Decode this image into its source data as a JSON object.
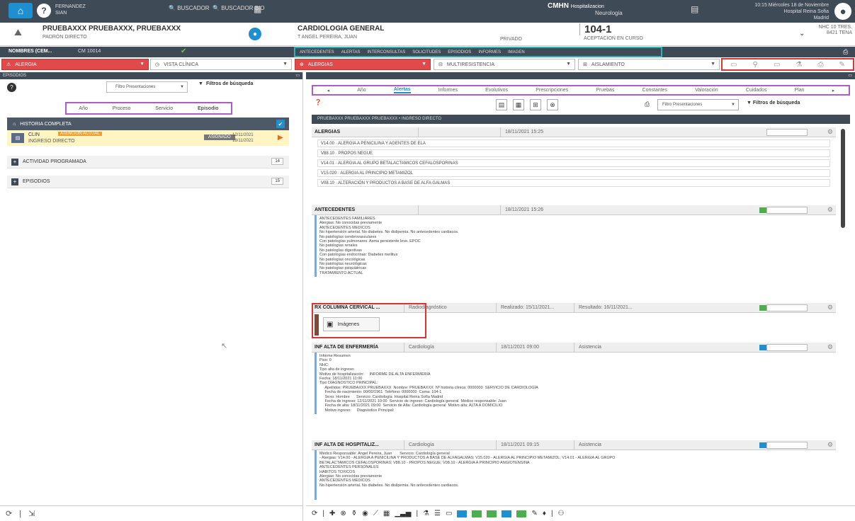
{
  "topbar": {
    "user_line1": "FERNANDEZ",
    "user_line2": "SIAN",
    "link1": "BUSCADOR",
    "link2": "BUSCADOR BIO",
    "center_title": "CMHN",
    "center_role": "Hospitalizacion",
    "center_sub": "Neurologia",
    "date_line1": "10:15 Miércoles 18 de Noviembre",
    "date_line2": "Hospital Reina Sofia",
    "date_line3": "Madrid"
  },
  "patient": {
    "name": "PRUEBAXXX PRUEBAXXX, PRUEBAXXX",
    "sub": "PADRÓN DIRECTO",
    "specialty": "CARDIOLOGIA GENERAL",
    "doctor": "T ANGEL PEREIRA, JUAN",
    "privado": "PRIVADO",
    "bed": "104-1",
    "bed_sub": "ACEPTACION EN CURSO",
    "right_info": "NHC 10 TRES, 8421 TENA"
  },
  "strip": {
    "label1": "NOMBRES (CEM...",
    "label2": "CM 10014",
    "tabs": [
      "ANTECEDENTES",
      "ALERTAS",
      "INTERCONSULTAS",
      "SOLICITUDES",
      "EPISODIOS",
      "INFORMES",
      "IMAGEN"
    ]
  },
  "alerts": {
    "alert_label": "ALERGIA",
    "clinical": "VISTA CLÍNICA",
    "red2": "ALERGIAS",
    "multi": "MULTIRESISTENCIA",
    "aislamiento": "AISLAMIENTO"
  },
  "left": {
    "header": "EPISODIOS",
    "filter_select": "Filtro Presentaciones",
    "filter_btn": "Filtros de búsqueda",
    "modes": [
      "Año",
      "Proceso",
      "Servicio",
      "Episodio"
    ],
    "section": "HISTORIA COMPLETA",
    "episode_title": "CLIN",
    "episode_badge": "ATENCIÓN ACTUAL",
    "episode_sub": "INGRESO DIRECTO",
    "episode_grey": "ASIGNADO",
    "episode_date1": "12/11/2021",
    "episode_date2": "18/11/2021",
    "group1": "ACTIVIDAD PROGRAMADA",
    "group1_count": "14",
    "group2": "EPISODIOS",
    "group2_count": "15"
  },
  "right": {
    "header": "",
    "tabs": [
      "Año",
      "Alertas",
      "Informes",
      "Evolutivos",
      "Prescripciones",
      "Pruebas",
      "Constantes",
      "Valoración",
      "Cuidados",
      "Plan"
    ],
    "active_tab": 1,
    "filter_select": "Filtro Presentaciones",
    "filter_btn": "Filtros de búsqueda",
    "dark_bar": "PRUEBAXXX PRUEBAXXX PRUEBAXXX • INGRESO DIRECTO",
    "alergias": {
      "title": "ALERGIAS",
      "date": "18/11/2021 15:25",
      "items": [
        "V14.00 · ALERGIA A PENICILINA Y AGENTES DE ELA",
        "V88.10 · PROPOS NEGUE",
        "V14.01 · ALERGIA AL GRUPO BETALACTAMICOS CEFALOSPORINAS",
        "V15.020 · ALERGIA AL PRINCIPIO METAMIZOL",
        "V08.10 · ALTERACIÓN Y PRODUCTOS A BASE DE ALFA GALMAS"
      ]
    },
    "antecedentes": {
      "title": "ANTECEDENTES",
      "date": "18/11/2021 15:26",
      "text": "ANTECEDENTES FAMILIARES\nAlergias: No conocidas previamente\nANTECEDENTES MEDICOS\nNo hipertensión arterial. No diabetes. No dislipemia. No antecedentes cardiacos.\nNo patologías cerebrovasculares\nCon patologías pulmonares: Asma persistente leve. EPOC\nNo patologías renales\nNo patologías digestivas\nCon patologías endocrinas: Diabetes mellitus\nNo patologías oncológicas\nNo patologías neurológicas\nNo patologías psiquiátricas\nTRATAMIENTO ACTUAL"
    },
    "rx": {
      "title": "RX COLUMNA CERVICAL ...",
      "c1": "Radiodiagnóstico",
      "c2": "Realizado: 15/11/2021...",
      "c3": "Resultado: 16/11/2021...",
      "btn": "Imágenes"
    },
    "alta_enf": {
      "title": "INF ALTA DE ENFERMERÍA",
      "c1": "Cardiología",
      "c2": "18/11/2021 09:00",
      "c3": "Asistencia",
      "text": "Informe Resumen\nPiso: 0\nNHC:\nTipo alta de ingreso:\nMotivo de hospitalización:     INFORME DE ALTA ENFERMERÍA\nFecha: 18/11/2021 11:00\nTipo DIAGNOSTICO PRINCIPAL:\n     Apellidos: PRUEBAXXX PRUEBAXXX  Nombre: PRUEBAXXX  Nº historia clínica: 0000000  SERVICIO DE CARDIOLOGÍA\n     Fecha de nacimiento: 00/00/1961  Teléfono: 0000000  Cama: 104-1\n     Sexo: Hombre      Servicio: Cardiología  Hospital Reina Sofía Madrid\n     Fecha de ingreso: 12/11/2021 10:00  Servicio de ingreso: Cardiología general  Médico responsable: Juan\n     Fecha de alta: 18/11/2021 09:00  Servicio de Alta: Cardiología general  Motivo alta: ALTA A DOMICILIO\n     Motivo ingreso:     Diagnóstico Principal:"
    },
    "alta_hosp": {
      "title": "INF ALTA DE HOSPITALIZ...",
      "c1": "Cardiología",
      "c2": "18/11/2021 09:15",
      "c3": "Asistencia",
      "text": "Médico Responsable: Angel Pereira, Juan       Servicio: Cardiología general\n- Alergias: V14.00 - ALERGIA A PENICILINA Y PRODUCTOS A BASE DE ALFAGALMAS; V15.020 - ALERGIA AL PRINCIPIO METAMIZOL; V14.01 - ALERGIA AL GRUPO\nBETALACTAMICOS CEFALOSPORINAS; V88.10 - PROPOS NEGUE; V08.10 - ALERGIA A PRINCIPIO ANGIOTENSINA\nANTECEDENTES PERSONALES\nHABITOS TOXICOS\nAlergias: No conocidas previamente\nANTECEDENTES MEDICOS\nNo hipertensión arterial. No diabetes. No dislipemia. No antecedentes cardiacos."
    }
  }
}
